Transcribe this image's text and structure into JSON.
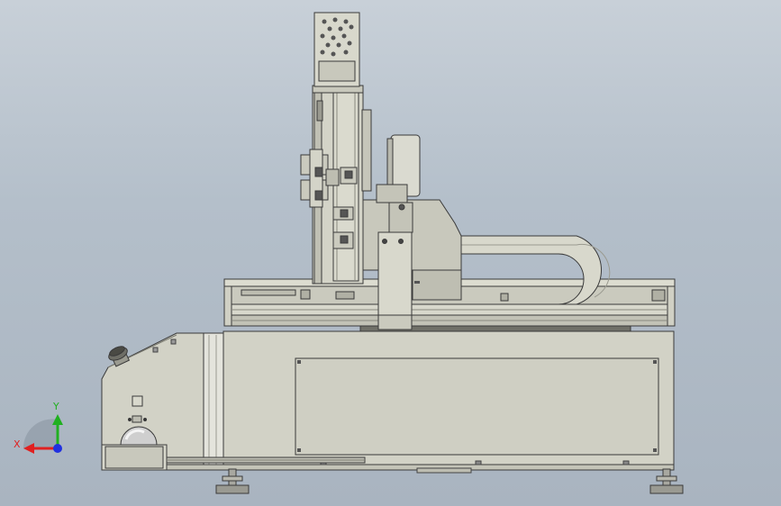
{
  "viewport": {
    "background_top": "#c8d0d8",
    "background_bottom": "#a9b4c0"
  },
  "model": {
    "body_color": "#d2d2c6",
    "dark_color": "#b4b4a8",
    "edge_color": "#3a3a3a",
    "accent_color": "#e8e8e0"
  },
  "triad": {
    "x_label": "X",
    "y_label": "Y",
    "x_color": "#e02020",
    "y_color": "#20b020",
    "z_color": "#2030e0"
  }
}
